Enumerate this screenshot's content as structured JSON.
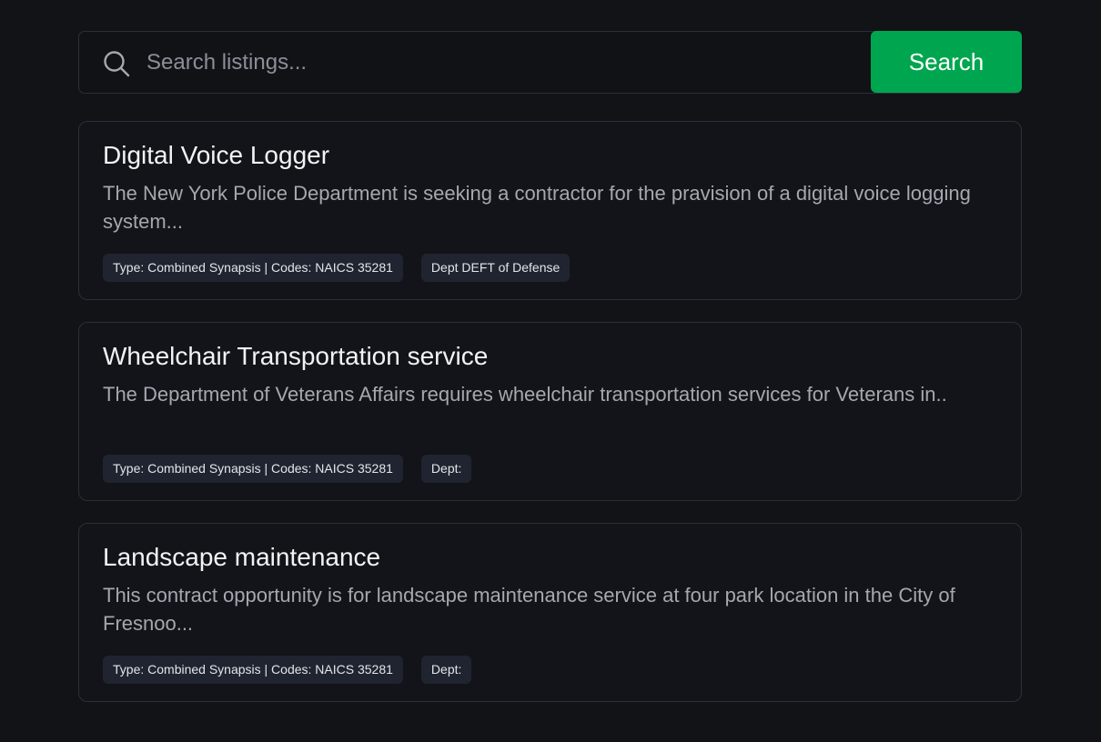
{
  "search": {
    "placeholder": "Search listings...",
    "button_label": "Search",
    "icon": "search-icon"
  },
  "listings": [
    {
      "title": "Digital Voice Logger",
      "description": "The New York Police Department is seeking a contractor for the pravision of a digital voice logging system...",
      "type_tag": "Type: Combined Synapsis | Codes: NAICS 35281",
      "dept_tag": "Dept DEFT of Defense"
    },
    {
      "title": "Wheelchair Transportation service",
      "description": "The Department of Veterans Affairs requires wheelchair transportation services for Veterans in..",
      "type_tag": "Type: Combined Synapsis | Codes: NAICS 35281",
      "dept_tag": "Dept:"
    },
    {
      "title": "Landscape maintenance",
      "description": "This contract opportunity is for landscape maintenance service at four park location in the City of Fresnoo...",
      "type_tag": "Type: Combined Synapsis | Codes: NAICS 35281",
      "dept_tag": "Dept:"
    }
  ],
  "colors": {
    "background": "#111317",
    "accent": "#00a64f",
    "card_border": "#2c2f36"
  }
}
